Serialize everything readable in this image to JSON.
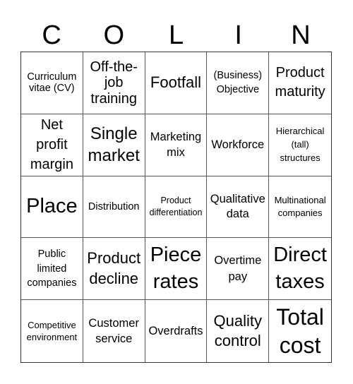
{
  "header": {
    "letters": [
      "C",
      "O",
      "L",
      "I",
      "N"
    ]
  },
  "cells": [
    "Curriculum vitae (CV)",
    "Off-the-job training",
    "Footfall",
    "(Business) Objective",
    "Product maturity",
    "Net profit margin",
    "Single market",
    "Marketing mix",
    "Workforce",
    "Hierarchical (tall) structures",
    "Place",
    "Distribution",
    "Product differentiation",
    "Qualitative data",
    "Multinational companies",
    "Public limited companies",
    "Product decline",
    "Piece rates",
    "Overtime pay",
    "Direct taxes",
    "Competitive environment",
    "Customer service",
    "Overdrafts",
    "Quality control",
    "Total cost"
  ]
}
